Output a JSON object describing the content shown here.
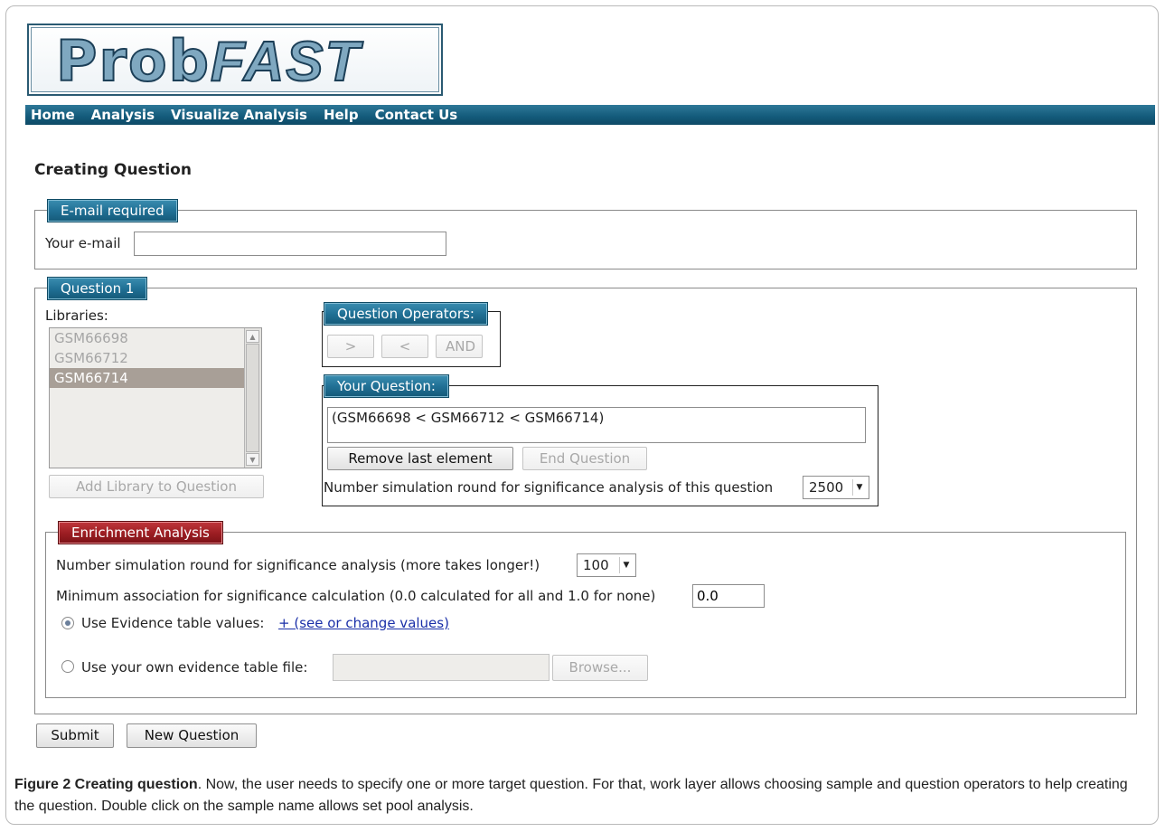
{
  "logo": {
    "part1": "Prob",
    "part2": "FAST"
  },
  "nav": [
    {
      "label": "Home"
    },
    {
      "label": "Analysis"
    },
    {
      "label": "Visualize Analysis"
    },
    {
      "label": "Help"
    },
    {
      "label": "Contact Us"
    }
  ],
  "page_title": "Creating Question",
  "email_section": {
    "legend": "E-mail required",
    "label": "Your e-mail",
    "value": ""
  },
  "question_section": {
    "legend": "Question 1",
    "libraries_label": "Libraries:",
    "libraries": [
      {
        "name": "GSM66698",
        "selected": false
      },
      {
        "name": "GSM66712",
        "selected": false
      },
      {
        "name": "GSM66714",
        "selected": true
      }
    ],
    "add_library_button": "Add Library to Question",
    "operators": {
      "legend": "Question Operators:",
      "buttons": [
        ">",
        "<",
        "AND"
      ]
    },
    "your_question": {
      "legend": "Your Question:",
      "expression": "(GSM66698 < GSM66712 < GSM66714)",
      "remove_button": "Remove last element",
      "end_button": "End Question",
      "sim_label": "Number simulation round for significance analysis of this question",
      "sim_value": "2500"
    }
  },
  "enrichment": {
    "legend": "Enrichment Analysis",
    "sim_label": "Number simulation round for significance analysis (more takes longer!)",
    "sim_value": "100",
    "min_assoc_label": "Minimum association for significance calculation (0.0 calculated for all and 1.0 for none)",
    "min_assoc_value": "0.0",
    "option_evidence_label": "Use Evidence table values:",
    "option_evidence_link": "+ (see or change values)",
    "option_own_label": "Use your own evidence table file:",
    "browse_button": "Browse...",
    "selected_option": "evidence"
  },
  "actions": {
    "submit": "Submit",
    "new_question": "New Question"
  },
  "caption": {
    "figure_label": "Figure 2 Creating question",
    "text": ". Now, the user needs to specify one or more target question. For that, work layer allows choosing sample and question operators to help creating the question. Double click on the sample name allows set pool analysis."
  },
  "colors": {
    "nav_blue": "#135a7a",
    "legend_blue": "#1f6e93",
    "legend_red": "#9b1d22",
    "link": "#1a2fa8",
    "selected_row": "#a89f97"
  }
}
